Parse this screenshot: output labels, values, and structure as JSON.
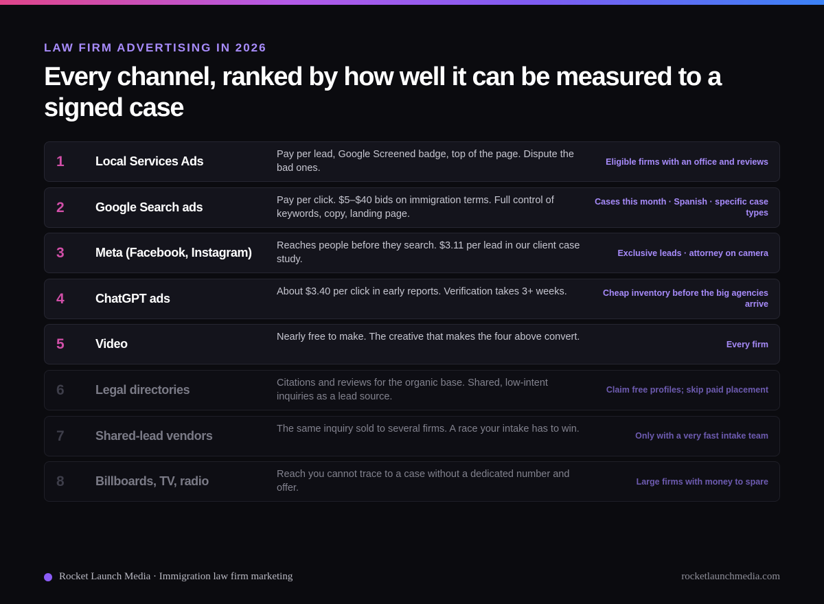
{
  "header": {
    "eyebrow": "LAW FIRM ADVERTISING IN 2026",
    "title": "Every channel, ranked by how well it can be measured to a signed case"
  },
  "channels": [
    {
      "rank": "1",
      "name": "Local Services Ads",
      "description": "Pay per lead, Google Screened badge, top of the page. Dispute the bad ones.",
      "best_for": "Eligible firms with an office and reviews",
      "muted": false
    },
    {
      "rank": "2",
      "name": "Google Search ads",
      "description": "Pay per click. $5–$40 bids on immigration terms. Full control of keywords, copy, landing page.",
      "best_for": "Cases this month · Spanish · specific case types",
      "muted": false
    },
    {
      "rank": "3",
      "name": "Meta (Facebook, Instagram)",
      "description": "Reaches people before they search. $3.11 per lead in our client case study.",
      "best_for": "Exclusive leads · attorney on camera",
      "muted": false
    },
    {
      "rank": "4",
      "name": "ChatGPT ads",
      "description": "About $3.40 per click in early reports. Verification takes 3+ weeks.",
      "best_for": "Cheap inventory before the big agencies arrive",
      "muted": false
    },
    {
      "rank": "5",
      "name": "Video",
      "description": "Nearly free to make. The creative that makes the four above convert.",
      "best_for": "Every firm",
      "muted": false
    },
    {
      "rank": "6",
      "name": "Legal directories",
      "description": "Citations and reviews for the organic base. Shared, low-intent inquiries as a lead source.",
      "best_for": "Claim free profiles; skip paid placement",
      "muted": true
    },
    {
      "rank": "7",
      "name": "Shared-lead vendors",
      "description": "The same inquiry sold to several firms. A race your intake has to win.",
      "best_for": "Only with a very fast intake team",
      "muted": true
    },
    {
      "rank": "8",
      "name": "Billboards, TV, radio",
      "description": "Reach you cannot trace to a case without a dedicated number and offer.",
      "best_for": "Large firms with money to spare",
      "muted": true
    }
  ],
  "footer": {
    "brand": "Rocket Launch Media · Immigration law firm marketing",
    "url": "rocketlaunchmedia.com"
  },
  "colors": {
    "accent": "#a78bfa",
    "rank": "#d14fa8",
    "background": "#0b0b0f"
  }
}
